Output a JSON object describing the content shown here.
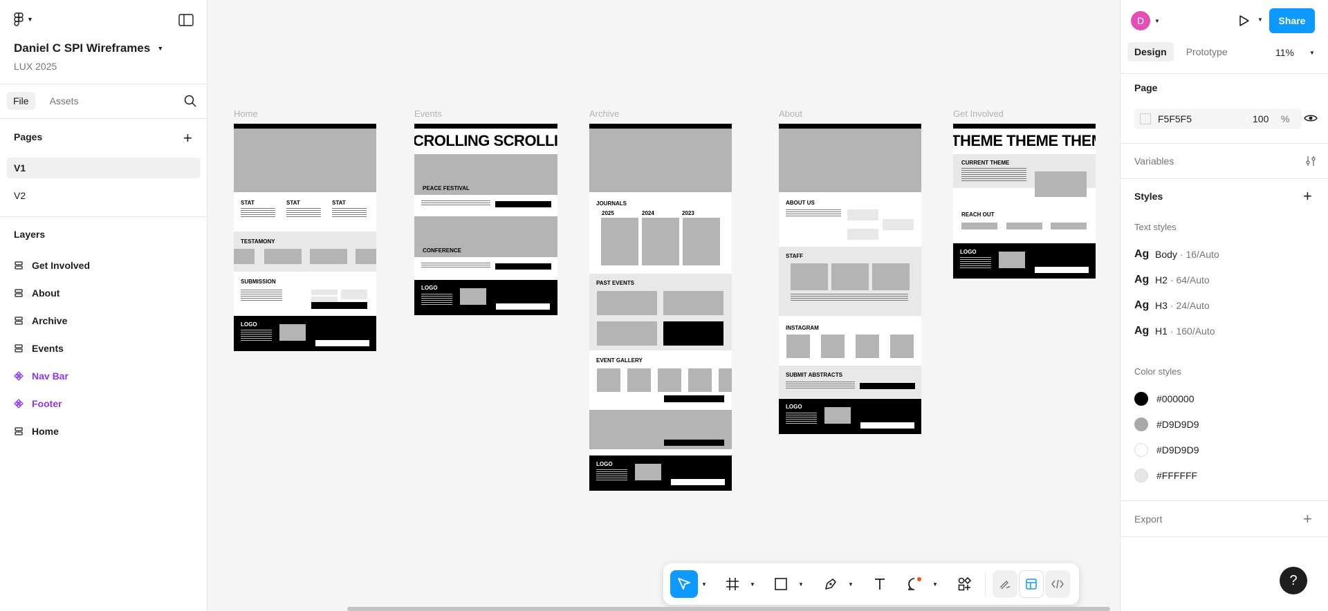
{
  "file": {
    "name": "Daniel C SPI Wireframes",
    "project": "LUX 2025"
  },
  "left_tabs": {
    "file": "File",
    "assets": "Assets"
  },
  "pages": {
    "title": "Pages",
    "items": [
      "V1",
      "V2"
    ]
  },
  "layers": {
    "title": "Layers",
    "items": [
      {
        "label": "Get Involved",
        "kind": "frame"
      },
      {
        "label": "About",
        "kind": "frame"
      },
      {
        "label": "Archive",
        "kind": "frame"
      },
      {
        "label": "Events",
        "kind": "frame"
      },
      {
        "label": "Nav Bar",
        "kind": "component"
      },
      {
        "label": "Footer",
        "kind": "component"
      },
      {
        "label": "Home",
        "kind": "frame"
      }
    ]
  },
  "header": {
    "avatar_initial": "D",
    "share": "Share",
    "zoom": "11%"
  },
  "right_tabs": {
    "design": "Design",
    "prototype": "Prototype"
  },
  "page_section": {
    "title": "Page",
    "fill_hex": "F5F5F5",
    "opacity": "100",
    "percent": "%"
  },
  "variables": {
    "title": "Variables"
  },
  "styles": {
    "title": "Styles",
    "text_title": "Text styles",
    "text_styles": [
      {
        "ag": "Ag",
        "name": "Body",
        "meta": "· 16/Auto"
      },
      {
        "ag": "Ag",
        "name": "H2",
        "meta": "· 64/Auto"
      },
      {
        "ag": "Ag",
        "name": "H3",
        "meta": "· 24/Auto"
      },
      {
        "ag": "Ag",
        "name": "H1",
        "meta": "· 160/Auto"
      }
    ],
    "color_title": "Color styles",
    "color_styles": [
      {
        "name": "#000000",
        "swatch": "#000000"
      },
      {
        "name": "#D9D9D9",
        "swatch": "#a9a9a9"
      },
      {
        "name": "#D9D9D9",
        "swatch": "#ffffff"
      },
      {
        "name": "#FFFFFF",
        "swatch": "#e6e6e6"
      }
    ]
  },
  "export": {
    "title": "Export"
  },
  "help": "?",
  "frames": {
    "home": {
      "label": "Home",
      "stats": [
        "STAT",
        "STAT",
        "STAT"
      ],
      "testimony": "TESTAMONY",
      "submission": "SUBMISSION",
      "logo": "LOGO"
    },
    "events": {
      "label": "Events",
      "marquee": "CROLLING SCROLLING",
      "peace": "PEACE FESTIVAL",
      "conference": "CONFERENCE",
      "logo": "LOGO"
    },
    "archive": {
      "label": "Archive",
      "journals": "JOURNALS",
      "years": [
        "2025",
        "2024",
        "2023"
      ],
      "past_events": "PAST EVENTS",
      "event_gallery": "EVENT GALLERY",
      "logo": "LOGO"
    },
    "about": {
      "label": "About",
      "about_us": "ABOUT US",
      "staff": "STAFF",
      "instagram": "INSTAGRAM",
      "submit_abstracts": "SUBMIT ABSTRACTS",
      "logo": "LOGO"
    },
    "get_involved": {
      "label": "Get Involved",
      "marquee": "THEME THEME THEME",
      "current_theme": "CURRENT THEME",
      "reach_out": "REACH OUT",
      "logo": "LOGO"
    }
  }
}
